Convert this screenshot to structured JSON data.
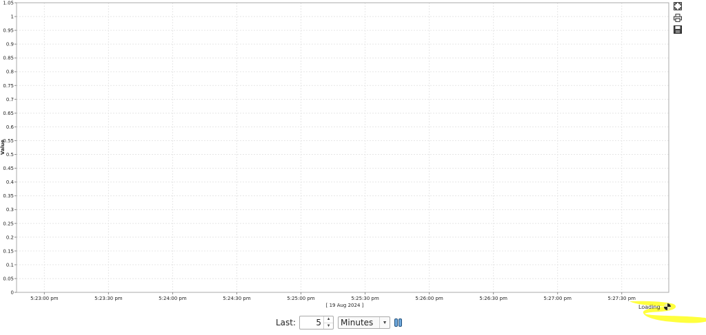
{
  "chart_data": {
    "type": "line",
    "xlabel": "[ 19 Aug 2024 ]",
    "ylabel": "Value",
    "yticks": [
      "0",
      "0.05",
      "0.1",
      "0.15",
      "0.2",
      "0.25",
      "0.3",
      "0.35",
      "0.4",
      "0.45",
      "0.5",
      "0.55",
      "0.6",
      "0.65",
      "0.7",
      "0.75",
      "0.8",
      "0.85",
      "0.9",
      "0.95",
      "1",
      "1.05"
    ],
    "ylim": [
      0,
      1.05
    ],
    "xticks": [
      "5:23:00 pm",
      "5:23:30 pm",
      "5:24:00 pm",
      "5:24:30 pm",
      "5:25:00 pm",
      "5:25:30 pm",
      "5:26:00 pm",
      "5:26:30 pm",
      "5:27:00 pm",
      "5:27:30 pm"
    ],
    "xlim": [
      "5:22:47 pm",
      "5:27:52 pm"
    ],
    "grid": true,
    "series": []
  },
  "toolbar": {
    "fullscreen_icon": "fullscreen-icon",
    "print_icon": "print-icon",
    "save_icon": "save-icon"
  },
  "status": {
    "loading": "Loading"
  },
  "controls": {
    "last_label": "Last:",
    "last_value": "5",
    "unit_selected": "Minutes"
  },
  "colors": {
    "highlight": "#ffff33",
    "grid": "#e6e6e6",
    "axis": "#888888"
  }
}
